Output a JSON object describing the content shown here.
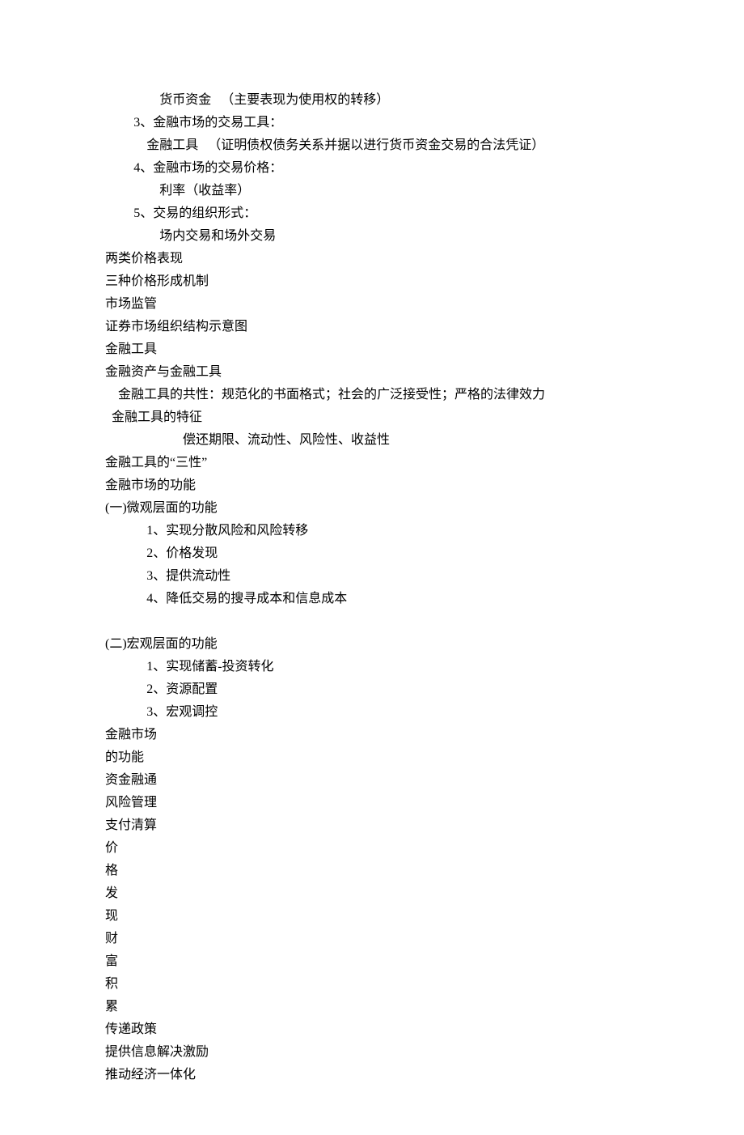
{
  "lines": [
    {
      "cls": "indent-3",
      "text": "货币资金   （主要表现为使用权的转移）"
    },
    {
      "cls": "indent-1",
      "text": "3、金融市场的交易工具："
    },
    {
      "cls": "indent-2",
      "text": "金融工具   （证明债权债务关系并据以进行货币资金交易的合法凭证）"
    },
    {
      "cls": "indent-1",
      "text": "4、金融市场的交易价格："
    },
    {
      "cls": "indent-3",
      "text": "利率（收益率）"
    },
    {
      "cls": "indent-1",
      "text": "5、交易的组织形式："
    },
    {
      "cls": "indent-3",
      "text": "场内交易和场外交易"
    },
    {
      "cls": "",
      "text": "两类价格表现"
    },
    {
      "cls": "",
      "text": "三种价格形成机制"
    },
    {
      "cls": "",
      "text": "市场监管"
    },
    {
      "cls": "",
      "text": "证券市场组织结构示意图"
    },
    {
      "cls": "",
      "text": "金融工具"
    },
    {
      "cls": "",
      "text": "金融资产与金融工具"
    },
    {
      "cls": "",
      "text": "    金融工具的共性：规范化的书面格式；社会的广泛接受性；严格的法律效力"
    },
    {
      "cls": "",
      "text": "  金融工具的特征"
    },
    {
      "cls": "indent-4",
      "text": "偿还期限、流动性、风险性、收益性"
    },
    {
      "cls": "",
      "text": "金融工具的“三性”"
    },
    {
      "cls": "",
      "text": "金融市场的功能"
    },
    {
      "cls": "",
      "text": "(一)微观层面的功能"
    },
    {
      "cls": "indent-2",
      "text": "1、实现分散风险和风险转移"
    },
    {
      "cls": "indent-2",
      "text": "2、价格发现"
    },
    {
      "cls": "indent-2",
      "text": "3、提供流动性"
    },
    {
      "cls": "indent-2",
      "text": "4、降低交易的搜寻成本和信息成本"
    },
    {
      "cls": "blank",
      "text": ""
    },
    {
      "cls": "",
      "text": "(二)宏观层面的功能"
    },
    {
      "cls": "indent-2",
      "text": "1、实现储蓄-投资转化"
    },
    {
      "cls": "indent-2",
      "text": "2、资源配置"
    },
    {
      "cls": "indent-2",
      "text": "3、宏观调控"
    },
    {
      "cls": "",
      "text": "金融市场"
    },
    {
      "cls": "",
      "text": "的功能"
    },
    {
      "cls": "",
      "text": "资金融通"
    },
    {
      "cls": "",
      "text": "风险管理"
    },
    {
      "cls": "",
      "text": "支付清算"
    },
    {
      "cls": "",
      "text": "价"
    },
    {
      "cls": "",
      "text": "格"
    },
    {
      "cls": "",
      "text": "发"
    },
    {
      "cls": "",
      "text": "现"
    },
    {
      "cls": "",
      "text": "财"
    },
    {
      "cls": "",
      "text": "富"
    },
    {
      "cls": "",
      "text": "积"
    },
    {
      "cls": "",
      "text": "累"
    },
    {
      "cls": "",
      "text": "传递政策"
    },
    {
      "cls": "",
      "text": "提供信息解决激励"
    },
    {
      "cls": "",
      "text": "推动经济一体化"
    }
  ]
}
